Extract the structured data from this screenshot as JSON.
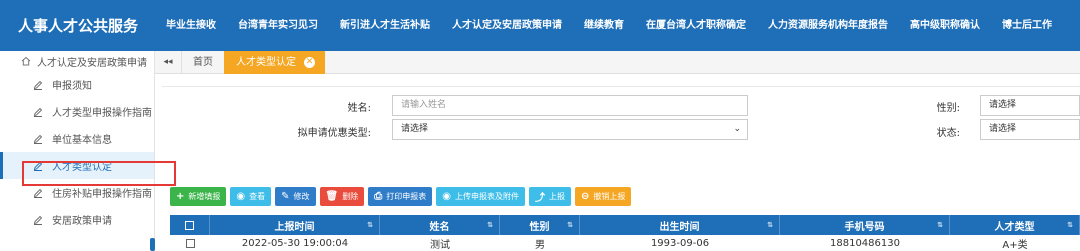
{
  "app": {
    "title": "人事人才公共服务"
  },
  "topnav": [
    "毕业生接收",
    "台湾青年实习见习",
    "新引进人才生活补贴",
    "人才认定及安居政策申请",
    "继续教育",
    "在厦台湾人才职称确定",
    "人力资源服务机构年度报告",
    "高中级职称确认",
    "博士后工作"
  ],
  "sidebar": {
    "header": "人才认定及安居政策申请",
    "items": [
      {
        "label": "申报须知",
        "active": false
      },
      {
        "label": "人才类型申报操作指南",
        "active": false
      },
      {
        "label": "单位基本信息",
        "active": false
      },
      {
        "label": "人才类型认定",
        "active": true
      },
      {
        "label": "住房补贴申报操作指南",
        "active": false
      },
      {
        "label": "安居政策申请",
        "active": false
      }
    ]
  },
  "tabs": {
    "collapse": "◂◂",
    "home": "首页",
    "active": "人才类型认定",
    "close": "✕"
  },
  "form": {
    "name_label": "姓名:",
    "name_placeholder": "请输入姓名",
    "policy_label": "拟申请优惠类型:",
    "policy_value": "请选择",
    "gender_label": "性别:",
    "gender_value": "请选择",
    "status_label": "状态:",
    "status_value": "请选择"
  },
  "toolbar": {
    "add": "新增填报",
    "view": "查看",
    "edit": "修改",
    "delete": "删除",
    "print": "打印申报表",
    "upload": "上传申报表及附件",
    "submit": "上报",
    "revoke": "撤销上报"
  },
  "table": {
    "headers": [
      "上报时间",
      "姓名",
      "性别",
      "出生时间",
      "手机号码",
      "人才类型"
    ],
    "rows": [
      [
        "2022-05-30 19:00:04",
        "测试",
        "男",
        "1993-09-06",
        "18810486130",
        "A+类"
      ]
    ]
  },
  "colors": {
    "brand_blue": "#1f6fb8",
    "tab_orange": "#f5a623",
    "highlight_red": "#e53935"
  }
}
